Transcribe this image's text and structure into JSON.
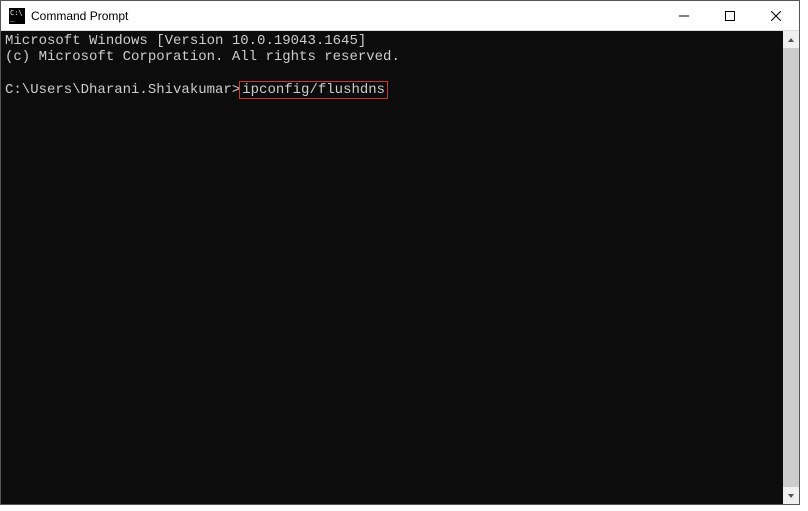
{
  "window": {
    "title": "Command Prompt"
  },
  "console": {
    "line1": "Microsoft Windows [Version 10.0.19043.1645]",
    "line2": "(c) Microsoft Corporation. All rights reserved.",
    "prompt": "C:\\Users\\Dharani.Shivakumar>",
    "command": "ipconfig/flushdns"
  }
}
